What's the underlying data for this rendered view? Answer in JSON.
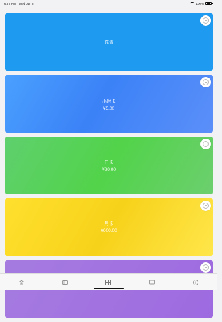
{
  "status_bar": {
    "time": "6:57 PM",
    "date": "Wed Jun 8",
    "battery_text": "100%"
  },
  "cards": [
    {
      "name": "充值",
      "price": ""
    },
    {
      "name": "小时卡",
      "price": "¥5.00"
    },
    {
      "name": "日卡",
      "price": "¥30.00"
    },
    {
      "name": "月卡",
      "price": "¥600.00"
    },
    {
      "name": "",
      "price": ""
    }
  ],
  "colors": {
    "recharge": "#1e9af0",
    "hour_card": "#3b82f7",
    "day_card": "#52d34a",
    "month_card": "#f7d21a",
    "fifth_card": "#9e6ae0"
  },
  "tabbar": {
    "items": [
      "home-icon",
      "ticket-icon",
      "grid-icon",
      "screen-icon",
      "info-icon"
    ]
  }
}
